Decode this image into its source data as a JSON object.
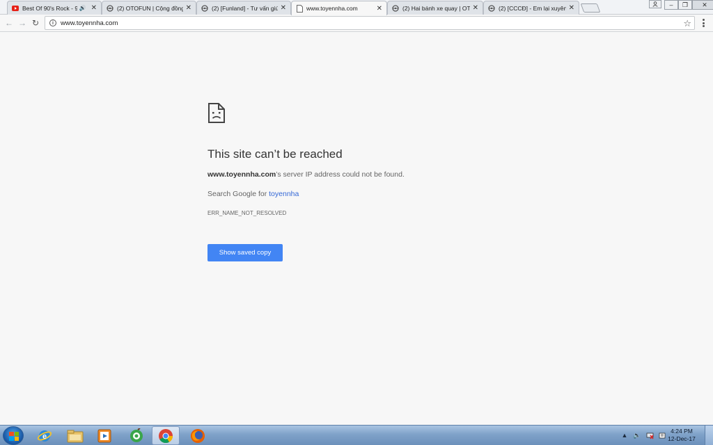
{
  "browser": {
    "tabs": [
      {
        "title": "Best Of 90's Rock - 90",
        "favicon": "youtube-icon",
        "audio": true,
        "close": "✕"
      },
      {
        "title": "(2) OTOFUN | Cộng đồng",
        "favicon": "steering-wheel-icon",
        "close": "✕"
      },
      {
        "title": "(2) [Funland] - Tư vấn giú",
        "favicon": "steering-wheel-icon",
        "close": "✕"
      },
      {
        "title": "www.toyennha.com",
        "favicon": "page-icon",
        "active": true,
        "close": "✕"
      },
      {
        "title": "(2) Hai bánh xe quay | OT",
        "favicon": "steering-wheel-icon",
        "close": "✕"
      },
      {
        "title": "(2) [CCCĐ] - Em lại xuyên",
        "favicon": "steering-wheel-icon",
        "close": "✕"
      }
    ],
    "address_bar": {
      "url": "www.toyennha.com",
      "info_icon": "i",
      "star_icon": "☆"
    },
    "nav": {
      "back": "←",
      "forward": "→",
      "reload": "↻"
    }
  },
  "error_page": {
    "heading": "This site can’t be reached",
    "summary_host": "www.toyennha.com",
    "summary_rest": "’s server IP address could not be found.",
    "search_prefix": "Search Google for ",
    "search_term": "toyennha",
    "error_code": "ERR_NAME_NOT_RESOLVED",
    "button_label": "Show saved copy"
  },
  "taskbar": {
    "apps": [
      "internet-explorer-icon",
      "file-explorer-icon",
      "media-player-icon",
      "coc-coc-icon",
      "chrome-icon",
      "firefox-icon"
    ],
    "clock_time": "4:24 PM",
    "clock_date": "12-Dec-17"
  },
  "colors": {
    "accent_button": "#4285f4",
    "link": "#3367d6",
    "youtube_red": "#e62117"
  }
}
